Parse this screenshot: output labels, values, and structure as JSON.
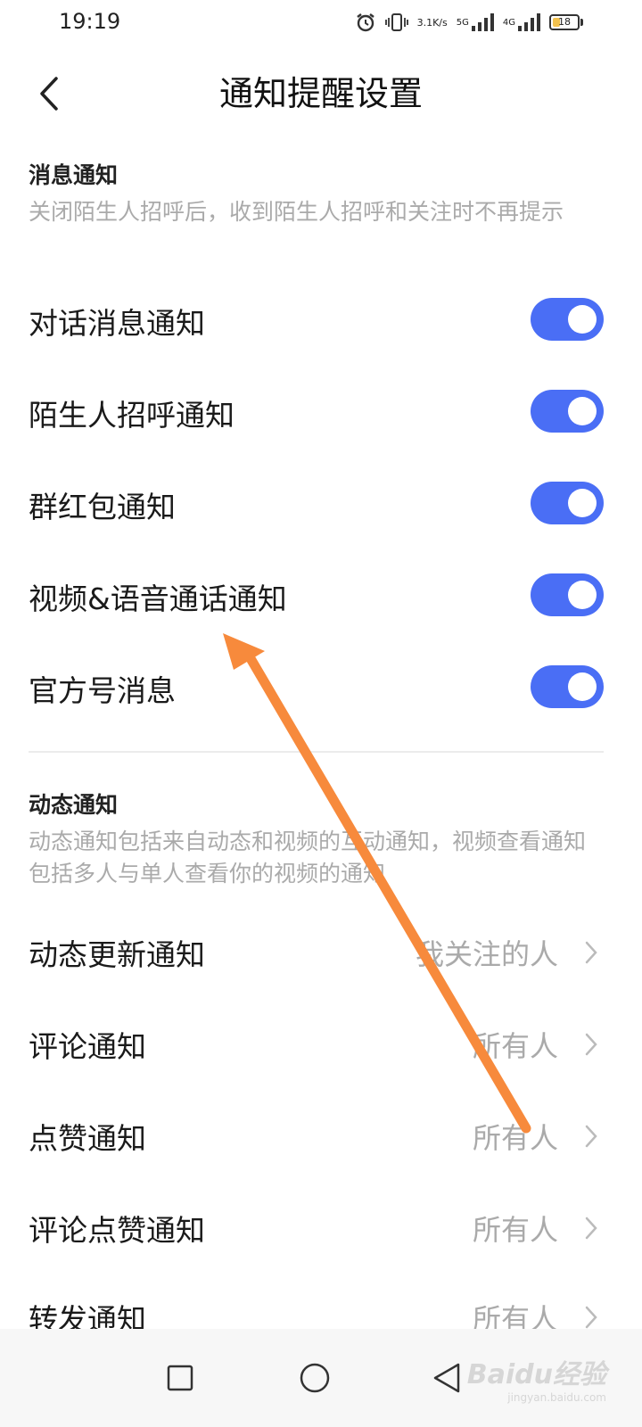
{
  "status_bar": {
    "time": "19:19",
    "net_speed_value": "3.1",
    "net_speed_unit": "K/s",
    "sim1_label": "5G",
    "sim2_label": "4G",
    "battery": "18",
    "icons": [
      "alarm-icon",
      "vibrate-icon",
      "signal-icon",
      "battery-icon"
    ]
  },
  "header": {
    "title": "通知提醒设置",
    "back_icon": "chevron-left-icon"
  },
  "message_section": {
    "title": "消息通知",
    "description": "关闭陌生人招呼后，收到陌生人招呼和关注时不再提示",
    "items": [
      {
        "label": "对话消息通知",
        "enabled": true
      },
      {
        "label": "陌生人招呼通知",
        "enabled": true
      },
      {
        "label": "群红包通知",
        "enabled": true
      },
      {
        "label": "视频&语音通话通知",
        "enabled": true
      },
      {
        "label": "官方号消息",
        "enabled": true
      }
    ]
  },
  "feed_section": {
    "title": "动态通知",
    "description": "动态通知包括来自动态和视频的互动通知，视频查看通知包括多人与单人查看你的视频的通知",
    "items": [
      {
        "label": "动态更新通知",
        "value": "我关注的人"
      },
      {
        "label": "评论通知",
        "value": "所有人"
      },
      {
        "label": "点赞通知",
        "value": "所有人"
      },
      {
        "label": "评论点赞通知",
        "value": "所有人"
      },
      {
        "label": "转发通知",
        "value": "所有人"
      }
    ]
  },
  "nav_bar": {
    "icons": [
      "recent-apps-icon",
      "home-icon",
      "back-icon"
    ]
  },
  "watermark": {
    "brand": "Baidu经验",
    "url": "jingyan.baidu.com"
  },
  "colors": {
    "toggle_on": "#4a6ef5",
    "annotation_arrow": "#f78a3c",
    "secondary_text": "#aaaaaa"
  }
}
